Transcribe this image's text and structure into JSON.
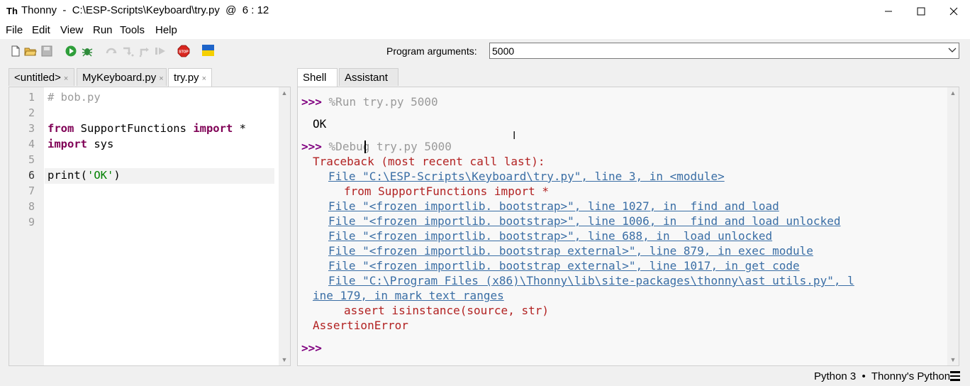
{
  "window": {
    "title": "Thonny  -  C:\\ESP-Scripts\\Keyboard\\try.py  @  6 : 12",
    "app_icon_glyph": "Th"
  },
  "menu": [
    "File",
    "Edit",
    "View",
    "Run",
    "Tools",
    "Help"
  ],
  "toolbar": {
    "program_arguments_label": "Program arguments:",
    "program_arguments_value": "5000"
  },
  "editor": {
    "tabs": [
      {
        "label": "<untitled>",
        "active": false
      },
      {
        "label": "MyKeyboard.py",
        "active": false
      },
      {
        "label": "try.py",
        "active": true
      }
    ],
    "line_numbers": [
      "1",
      "2",
      "3",
      "4",
      "5",
      "6",
      "7",
      "8",
      "9"
    ],
    "current_line": 6,
    "code": {
      "l1": "# bob.py",
      "l3_kw1": "from",
      "l3_mid": " SupportFunctions ",
      "l3_kw2": "import",
      "l3_end": " *",
      "l4_kw": "import",
      "l4_end": " sys",
      "l6_pre": "print(",
      "l6_str": "'OK'",
      "l6_post": ")"
    }
  },
  "shell": {
    "tabs": [
      {
        "label": "Shell",
        "active": true
      },
      {
        "label": "Assistant",
        "active": false
      }
    ],
    "prompt": ">>>",
    "cmd1": "%Run try.py 5000",
    "out1": "OK",
    "cmd2": "%Debug try.py 5000",
    "traceback_header": "Traceback (most recent call last):",
    "tb1": "File \"C:\\ESP-Scripts\\Keyboard\\try.py\", line 3, in <module>",
    "tb1_src": "from SupportFunctions import *",
    "tb2": "File \"<frozen importlib. bootstrap>\", line 1027, in  find and load",
    "tb3": "File \"<frozen importlib. bootstrap>\", line 1006, in  find and load unlocked",
    "tb4": "File \"<frozen importlib. bootstrap>\", line 688, in  load unlocked",
    "tb5": "File \"<frozen importlib. bootstrap external>\", line 879, in exec module",
    "tb6": "File \"<frozen importlib. bootstrap external>\", line 1017, in get code",
    "tb7a": "File \"C:\\Program Files (x86)\\Thonny\\lib\\site-packages\\thonny\\ast utils.py\", l",
    "tb7b": "ine 179, in mark text ranges",
    "tb7_src": "assert isinstance(source, str)",
    "error": "AssertionError",
    "final_prompt": ">>>"
  },
  "status": {
    "text": "Python 3  •  Thonny's Python"
  },
  "colors": {
    "keyword": "#7f0055",
    "string": "#008000",
    "prompt": "#7f007f",
    "error": "#b22222",
    "link": "#3a6ea5"
  }
}
